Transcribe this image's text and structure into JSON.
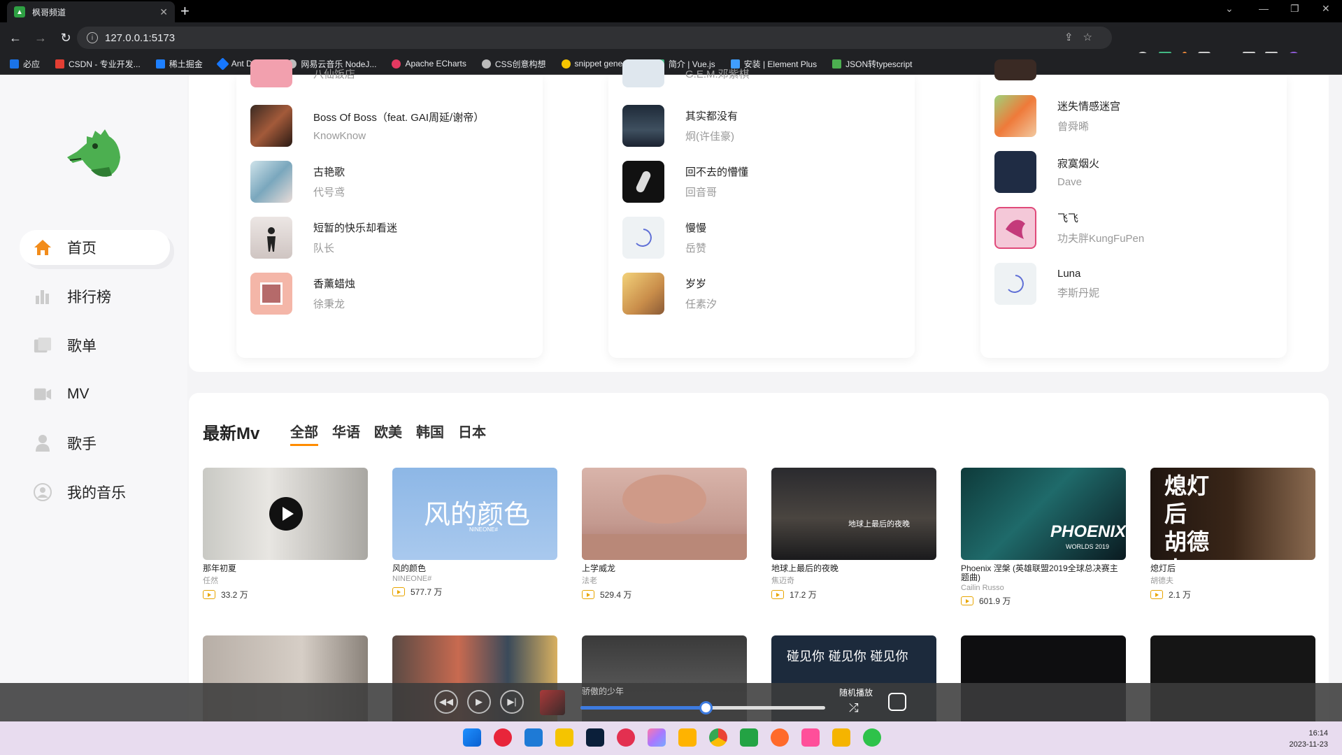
{
  "browser": {
    "tab_title": "枫哥频道",
    "url": "127.0.0.1:5173",
    "bookmarks": [
      {
        "label": "必应",
        "color": "#1a73e8"
      },
      {
        "label": "CSDN - 专业开发...",
        "color": "#e33e33"
      },
      {
        "label": "稀土掘金",
        "color": "#1e80ff"
      },
      {
        "label": "Ant Design",
        "color": "#1677ff"
      },
      {
        "label": "网易云音乐 NodeJ...",
        "color": "#bbbbbb"
      },
      {
        "label": "Apache ECharts",
        "color": "#e43961"
      },
      {
        "label": "CSS创意构想",
        "color": "#bbbbbb"
      },
      {
        "label": "snippet generator",
        "color": "#f5c400"
      },
      {
        "label": "简介 | Vue.js",
        "color": "#42b883"
      },
      {
        "label": "安装 | Element Plus",
        "color": "#409eff"
      },
      {
        "label": "JSON转typescript",
        "color": "#4caf50"
      }
    ]
  },
  "sidebar": {
    "items": [
      {
        "label": "首页",
        "active": true,
        "icon": "home-icon"
      },
      {
        "label": "排行榜",
        "active": false,
        "icon": "chart-icon"
      },
      {
        "label": "歌单",
        "active": false,
        "icon": "playlist-icon"
      },
      {
        "label": "MV",
        "active": false,
        "icon": "video-icon"
      },
      {
        "label": "歌手",
        "active": false,
        "icon": "singer-icon"
      },
      {
        "label": "我的音乐",
        "active": false,
        "icon": "user-icon"
      }
    ]
  },
  "song_columns": [
    {
      "partial_top": {
        "name": "",
        "artist": "八仙饭店"
      },
      "songs": [
        {
          "name": "Boss Of Boss（feat. GAI周延/谢帝）",
          "artist": "KnowKnow"
        },
        {
          "name": "古艳歌",
          "artist": "代号鸢"
        },
        {
          "name": "短暂的快乐却看迷",
          "artist": "队长"
        },
        {
          "name": "香薰蜡烛",
          "artist": "徐秉龙"
        }
      ]
    },
    {
      "partial_top": {
        "name": "",
        "artist": "G.E.M.邓紫棋"
      },
      "songs": [
        {
          "name": "其实都没有",
          "artist": "炯(许佳豪)"
        },
        {
          "name": "回不去的懵懂",
          "artist": "回音哥"
        },
        {
          "name": "慢慢",
          "artist": "岳赞"
        },
        {
          "name": "岁岁",
          "artist": "任素汐"
        }
      ]
    },
    {
      "partial_top": {
        "name": "",
        "artist": ""
      },
      "songs": [
        {
          "name": "迷失情感迷宫",
          "artist": "曾舜晞"
        },
        {
          "name": "寂寞烟火",
          "artist": "Dave"
        },
        {
          "name": "飞飞",
          "artist": "功夫胖KungFuPen"
        },
        {
          "name": "Luna",
          "artist": "李斯丹妮"
        }
      ]
    }
  ],
  "mv_section": {
    "title": "最新Mv",
    "filters": [
      "全部",
      "华语",
      "欧美",
      "韩国",
      "日本"
    ],
    "active_filter": "全部",
    "mvs": [
      {
        "name": "那年初夏",
        "artist": "任然",
        "plays": "33.2 万"
      },
      {
        "name": "风的颜色",
        "artist": "NINEONE#",
        "plays": "577.7 万"
      },
      {
        "name": "上学威龙",
        "artist": "法老",
        "plays": "529.4 万"
      },
      {
        "name": "地球上最后的夜晚",
        "artist": "焦迈奇",
        "plays": "17.2 万"
      },
      {
        "name": "Phoenix 涅槃 (英雄联盟2019全球总决赛主题曲)",
        "artist": "Cailin Russo",
        "plays": "601.9 万"
      },
      {
        "name": "熄灯后",
        "artist": "胡德夫",
        "plays": "2.1 万"
      }
    ],
    "thumb_texts": {
      "mv2": "风的颜色",
      "mv2_sub": "NINEONE#",
      "mv5": "PHOENIX",
      "mv5_sub": "WORLDS 2019",
      "mv6": "熄灯后 胡德夫",
      "mv4": "地球上最后的夜晚",
      "row2_4": "碰见你 碰见你 碰见你"
    }
  },
  "player": {
    "current_song": "骄傲的少年",
    "mode_label": "随机播放",
    "progress": 0.51
  },
  "taskbar": {
    "time": "16:14",
    "date": "2023-11-23"
  }
}
